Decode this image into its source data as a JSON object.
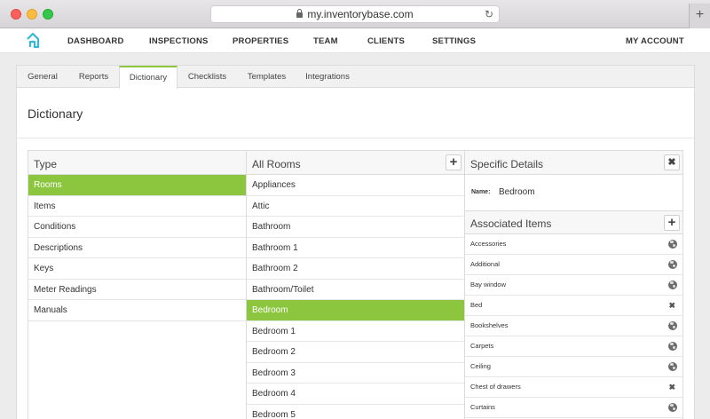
{
  "browser": {
    "url": "my.inventorybase.com",
    "newtab_glyph": "+",
    "reload_glyph": "↻"
  },
  "nav": {
    "items": [
      "DASHBOARD",
      "INSPECTIONS",
      "PROPERTIES",
      "TEAM",
      "CLIENTS",
      "SETTINGS"
    ],
    "account": "MY ACCOUNT"
  },
  "tabs": [
    "General",
    "Reports",
    "Dictionary",
    "Checklists",
    "Templates",
    "Integrations"
  ],
  "active_tab": "Dictionary",
  "page_title": "Dictionary",
  "type_column": {
    "title": "Type",
    "items": [
      "Rooms",
      "Items",
      "Conditions",
      "Descriptions",
      "Keys",
      "Meter Readings",
      "Manuals"
    ],
    "selected": "Rooms"
  },
  "rooms_column": {
    "title": "All Rooms",
    "add_glyph": "+",
    "items": [
      "Appliances",
      "Attic",
      "Bathroom",
      "Bathroom 1",
      "Bathroom 2",
      "Bathroom/Toilet",
      "Bedroom",
      "Bedroom 1",
      "Bedroom 2",
      "Bedroom 3",
      "Bedroom 4",
      "Bedroom 5"
    ],
    "selected": "Bedroom"
  },
  "details": {
    "title": "Specific Details",
    "close_glyph": "✖",
    "name_label": "Name:",
    "name_value": "Bedroom",
    "assoc_title": "Associated Items",
    "add_glyph": "+",
    "items": [
      {
        "label": "Accessories",
        "icon": "globe-icon"
      },
      {
        "label": "Additional",
        "icon": "globe-icon"
      },
      {
        "label": "Bay window",
        "icon": "globe-icon"
      },
      {
        "label": "Bed",
        "icon": "remove-icon"
      },
      {
        "label": "Bookshelves",
        "icon": "globe-icon"
      },
      {
        "label": "Carpets",
        "icon": "globe-icon"
      },
      {
        "label": "Ceiling",
        "icon": "globe-icon"
      },
      {
        "label": "Chest of drawers",
        "icon": "remove-icon"
      },
      {
        "label": "Curtains",
        "icon": "globe-icon"
      }
    ],
    "remove_glyph": "✖"
  },
  "colors": {
    "accent": "#8cc63f",
    "logo": "#35b8d8"
  }
}
